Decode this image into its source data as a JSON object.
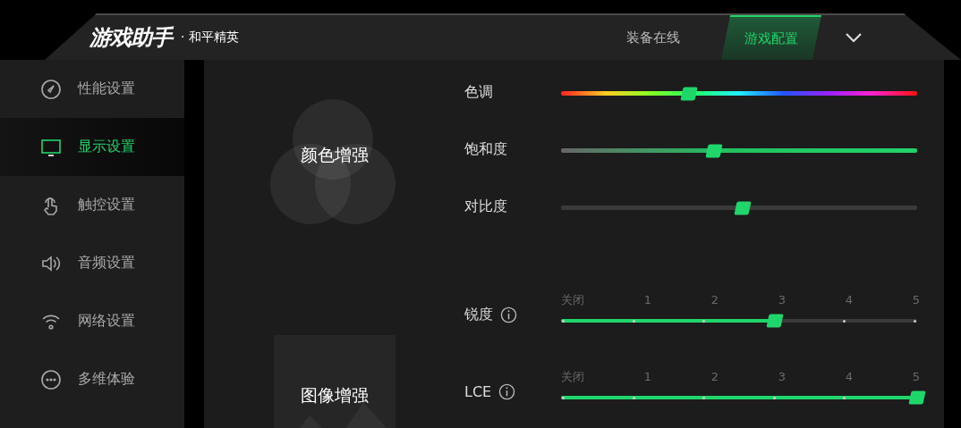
{
  "header": {
    "app_title": "游戏助手",
    "game": "· 和平精英",
    "tabs": [
      {
        "label": "装备在线",
        "selected": false
      },
      {
        "label": "游戏配置",
        "selected": true
      }
    ]
  },
  "sidebar": {
    "items": [
      {
        "label": "性能设置",
        "selected": false
      },
      {
        "label": "显示设置",
        "selected": true
      },
      {
        "label": "触控设置",
        "selected": false
      },
      {
        "label": "音频设置",
        "selected": false
      },
      {
        "label": "网络设置",
        "selected": false
      },
      {
        "label": "多维体验",
        "selected": false
      }
    ]
  },
  "color_enhance": {
    "title": "颜色增强",
    "sliders": [
      {
        "label": "色调",
        "kind": "hue",
        "level": 0.36
      },
      {
        "label": "饱和度",
        "kind": "saturation",
        "level": 0.43
      },
      {
        "label": "对比度",
        "kind": "contrast",
        "level": 0.51
      }
    ]
  },
  "image_enhance": {
    "title": "图像增强",
    "sliders": [
      {
        "label": "锐度",
        "ticks": [
          "关闭",
          "1",
          "2",
          "3",
          "4",
          "5"
        ],
        "level": 0.6
      },
      {
        "label": "LCE",
        "ticks": [
          "关闭",
          "1",
          "2",
          "3",
          "4",
          "5"
        ],
        "level": 1
      }
    ]
  }
}
